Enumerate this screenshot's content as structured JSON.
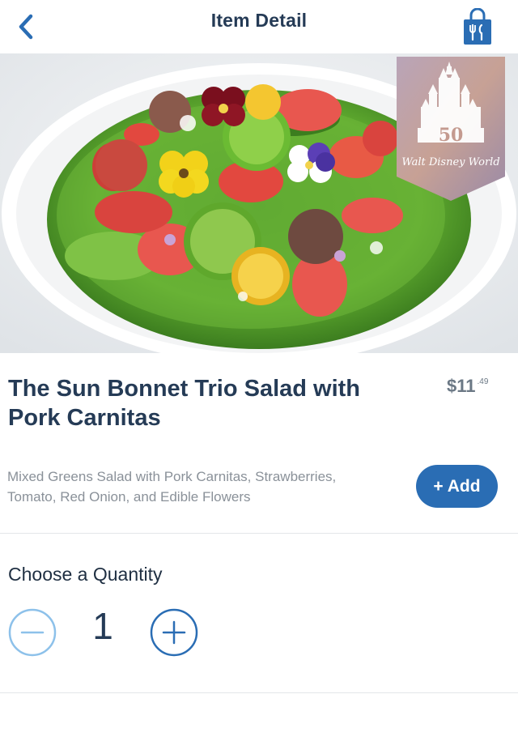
{
  "header": {
    "title": "Item Detail",
    "back_icon": "chevron-left-icon",
    "bag_icon": "shopping-bag-utensils-icon"
  },
  "hero": {
    "badge": {
      "number": "50",
      "brand": "Walt Disney World"
    }
  },
  "item": {
    "name": "The Sun Bonnet Trio Salad with Pork Carnitas",
    "price_dollars": "$11",
    "price_cents": ".49",
    "description": "Mixed Greens Salad with Pork Carnitas, Strawberries, Tomato, Red Onion, and Edible Flowers",
    "add_label": "+ Add"
  },
  "quantity": {
    "label": "Choose a Quantity",
    "value": "1",
    "minus_icon": "minus-circle-icon",
    "plus_icon": "plus-circle-icon"
  },
  "colors": {
    "primary_text": "#253b56",
    "accent_blue": "#2a6db4",
    "muted_text": "#8a9199"
  }
}
